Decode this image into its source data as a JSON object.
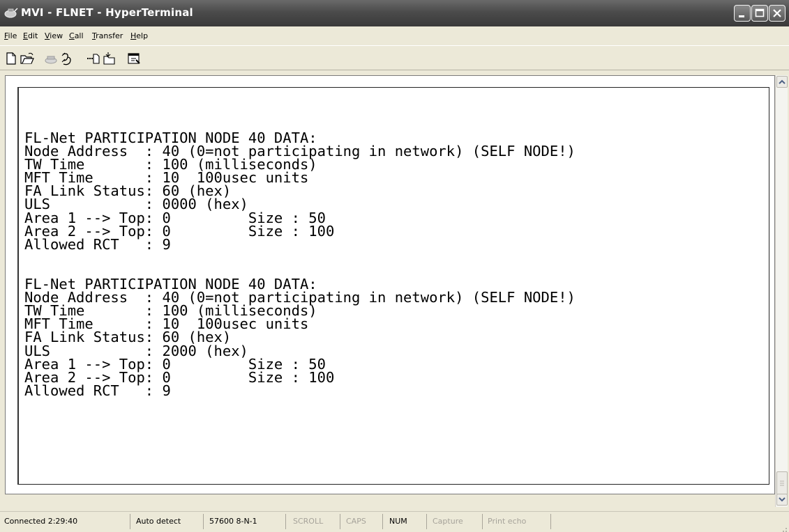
{
  "window": {
    "title": "MVI - FLNET - HyperTerminal"
  },
  "menu": [
    {
      "accel": "F",
      "rest": "ile"
    },
    {
      "accel": "E",
      "rest": "dit"
    },
    {
      "accel": "V",
      "rest": "iew"
    },
    {
      "accel": "C",
      "rest": "all"
    },
    {
      "accel": "T",
      "rest": "ransfer"
    },
    {
      "accel": "H",
      "rest": "elp"
    }
  ],
  "toolbar": [
    "new-icon",
    "open-icon",
    "call-icon",
    "disconnect-icon",
    "send-icon",
    "receive-icon",
    "properties-icon"
  ],
  "terminal": {
    "lines": [
      "FL-Net PARTICIPATION NODE 40 DATA:",
      "Node Address  : 40 (0=not participating in network) (SELF NODE!)",
      "TW Time       : 100 (milliseconds)",
      "MFT Time      : 10  100usec units",
      "FA Link Status: 60 (hex)",
      "ULS           : 0000 (hex)",
      "Area 1 --> Top: 0         Size : 50",
      "Area 2 --> Top: 0         Size : 100",
      "Allowed RCT   : 9",
      "",
      "",
      "FL-Net PARTICIPATION NODE 40 DATA:",
      "Node Address  : 40 (0=not participating in network) (SELF NODE!)",
      "TW Time       : 100 (milliseconds)",
      "MFT Time      : 10  100usec units",
      "FA Link Status: 60 (hex)",
      "ULS           : 2000 (hex)",
      "Area 1 --> Top: 0         Size : 50",
      "Area 2 --> Top: 0         Size : 100",
      "Allowed RCT   : 9"
    ]
  },
  "status": {
    "connected": "Connected 2:29:40",
    "detect": "Auto detect",
    "port": "57600 8-N-1",
    "scroll": "SCROLL",
    "caps": "CAPS",
    "num": "NUM",
    "capture": "Capture",
    "print_echo": "Print echo"
  }
}
